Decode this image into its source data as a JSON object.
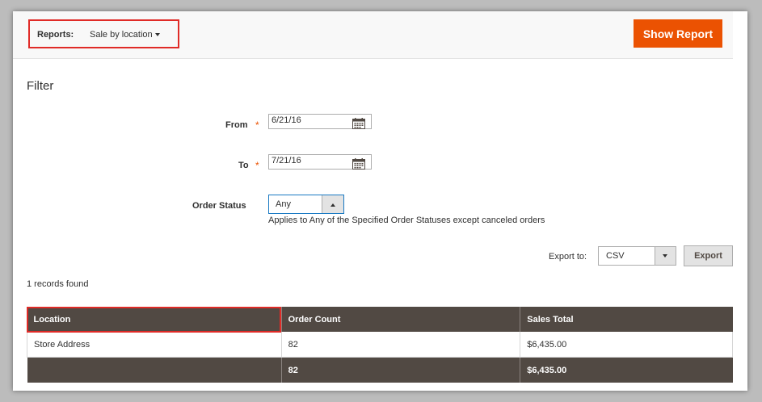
{
  "header": {
    "reports_label": "Reports:",
    "reports_value": "Sale by location",
    "show_report_label": "Show Report"
  },
  "filter": {
    "title": "Filter",
    "from_label": "From",
    "from_value": "6/21/16",
    "to_label": "To",
    "to_value": "7/21/16",
    "required_mark": "*",
    "order_status_label": "Order Status",
    "order_status_value": "Any",
    "order_status_note": "Applies to Any of the Specified Order Statuses except canceled orders"
  },
  "export": {
    "label": "Export to:",
    "format_value": "CSV",
    "button_label": "Export"
  },
  "grid": {
    "records_text": "1 records found",
    "columns": [
      "Location",
      "Order Count",
      "Sales Total"
    ],
    "rows": [
      [
        "Store Address",
        "82",
        "$6,435.00"
      ]
    ],
    "totals": [
      "",
      "82",
      "$6,435.00"
    ]
  },
  "colors": {
    "accent": "#eb5202",
    "highlight": "#e02b27",
    "grid_header": "#514943",
    "focus": "#1979c3"
  },
  "icons": {
    "calendar": "calendar-icon",
    "dropdown": "chevron-down-icon"
  }
}
